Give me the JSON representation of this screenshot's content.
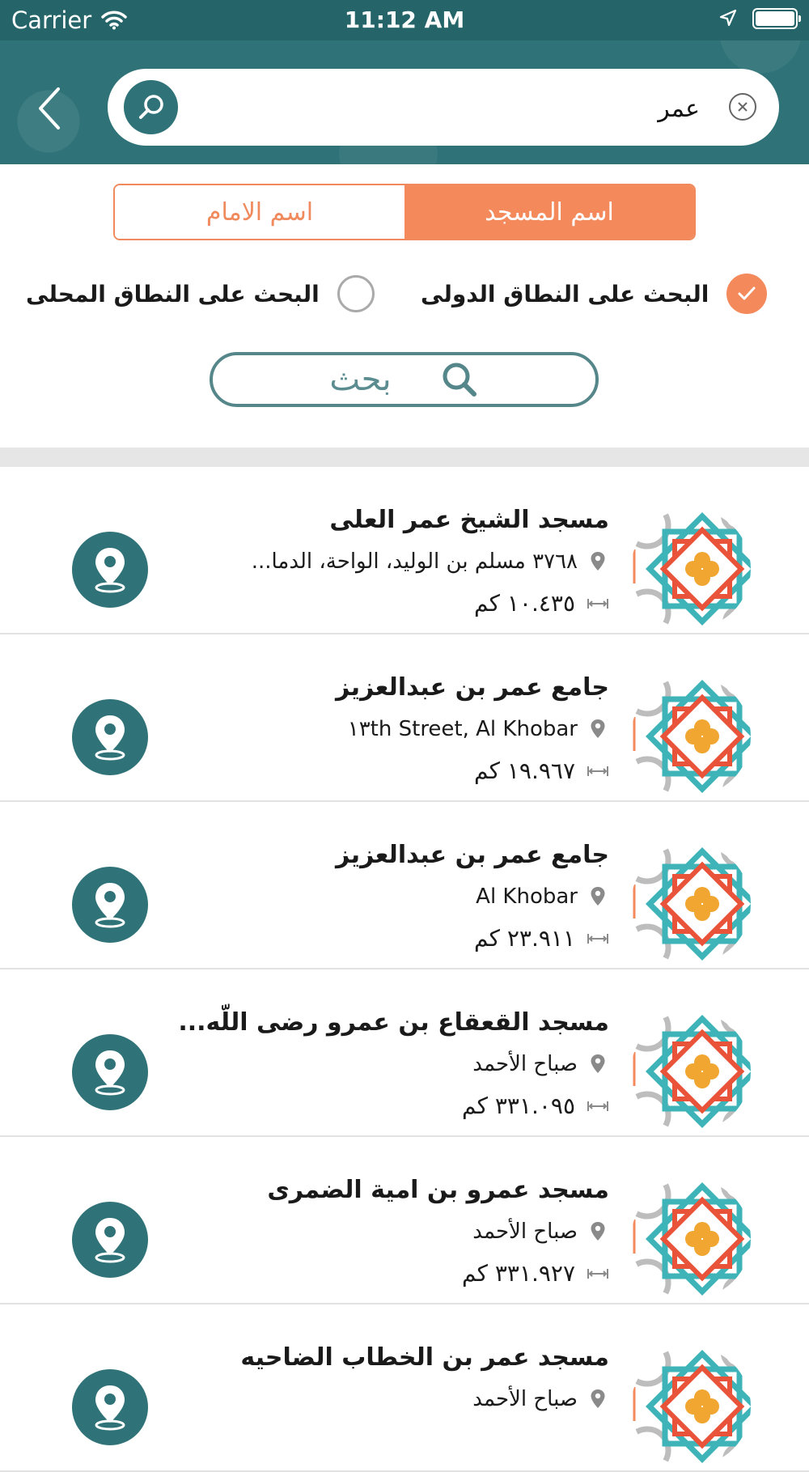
{
  "status_bar": {
    "carrier": "Carrier",
    "time": "11:12 AM"
  },
  "search": {
    "query": "عمر"
  },
  "tabs": {
    "imam_name": "اسم الامام",
    "mosque_name": "اسم المسجد",
    "selected": "mosque_name"
  },
  "scope": {
    "international": {
      "label": "البحث على النطاق الدولى",
      "checked": true
    },
    "local": {
      "label": "البحث على النطاق المحلى",
      "checked": false
    }
  },
  "search_button": {
    "label": "بحث"
  },
  "accent_color": "#f48a5c",
  "primary_color": "#2f7378",
  "results": [
    {
      "name": "مسجد الشيخ عمر العلى",
      "address": "٣٧٦٨ مسلم بن الوليد، الواحة، الدما...",
      "distance": "١٠.٤٣٥ كم"
    },
    {
      "name": "جامع عمر بن عبدالعزيز",
      "address": "١٣th Street, Al Khobar",
      "distance": "١٩.٩٦٧ كم"
    },
    {
      "name": "جامع عمر بن عبدالعزيز",
      "address": "Al Khobar",
      "distance": "٢٣.٩١١ كم"
    },
    {
      "name": "مسجد القعقاع بن عمرو رضى اللّه...",
      "address": "صباح الأحمد",
      "distance": "٣٣١.٠٩٥ كم"
    },
    {
      "name": "مسجد عمرو بن امية الضمرى",
      "address": "صباح الأحمد",
      "distance": "٣٣١.٩٢٧ كم"
    },
    {
      "name": "مسجد عمر بن الخطاب الضاحيه",
      "address": "صباح الأحمد",
      "distance": ""
    }
  ]
}
